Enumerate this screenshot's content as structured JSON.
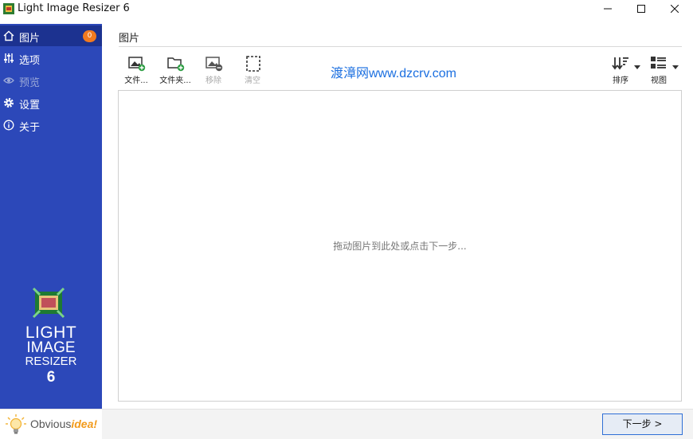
{
  "window": {
    "title": "Light Image Resizer 6",
    "app_icon": "film-frame-icon",
    "controls": [
      "minimize-icon",
      "maximize-icon",
      "close-icon"
    ]
  },
  "sidebar": {
    "accent": "#2c48b9",
    "items": [
      {
        "label": "图片",
        "icon": "home-icon",
        "badge": "0",
        "active": true
      },
      {
        "label": "选项",
        "icon": "sliders-icon"
      },
      {
        "label": "预览",
        "icon": "eye-icon",
        "disabled": true
      },
      {
        "label": "设置",
        "icon": "gear-icon"
      },
      {
        "label": "关于",
        "icon": "info-icon"
      }
    ],
    "logo": {
      "line1": "LIGHT",
      "line2": "IMAGE",
      "line3": "RESIZER",
      "line4": "6"
    },
    "brand": {
      "prefix": "Obvious",
      "suffix": "idea!"
    }
  },
  "main": {
    "section_title": "图片",
    "toolbar": {
      "add_file": "文件...",
      "add_folder": "文件夹...",
      "remove": "移除",
      "clear": "清空",
      "sort": "排序",
      "view": "视图"
    },
    "watermark": "渡漳网www.dzcrv.com",
    "drop_hint": "拖动图片到此处或点击下一步..."
  },
  "footer": {
    "next_label": "下一步 >"
  }
}
